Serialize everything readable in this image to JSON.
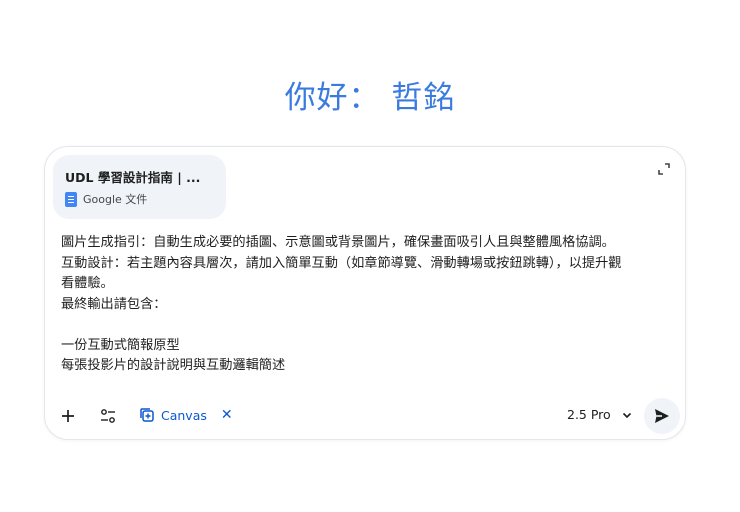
{
  "greeting": "你好： 哲銘",
  "attachment": {
    "title": "UDL 學習設計指南 | ...",
    "type_label": "Google 文件",
    "icon": "google-docs-icon"
  },
  "prompt_lines": [
    "圖片生成指引：自動生成必要的插圖、示意圖或背景圖片，確保畫面吸引人且與整體風格協調。",
    "互動設計：若主題內容具層次，請加入簡單互動（如章節導覽、滑動轉場或按鈕跳轉），以提升觀",
    "看體驗。",
    "最終輸出請包含：",
    "",
    "一份互動式簡報原型",
    "每張投影片的設計說明與互動邏輯簡述"
  ],
  "toolbar": {
    "add_icon": "plus-icon",
    "tools_icon": "tools-sliders-icon",
    "canvas_label": "Canvas",
    "canvas_close": "✕",
    "model_label": "2.5 Pro",
    "send_icon": "send-icon"
  },
  "colors": {
    "greeting": "#3b7be0",
    "accent": "#0b57d0",
    "attachment_bg": "#f0f4f9",
    "docs_blue": "#4285f4"
  }
}
